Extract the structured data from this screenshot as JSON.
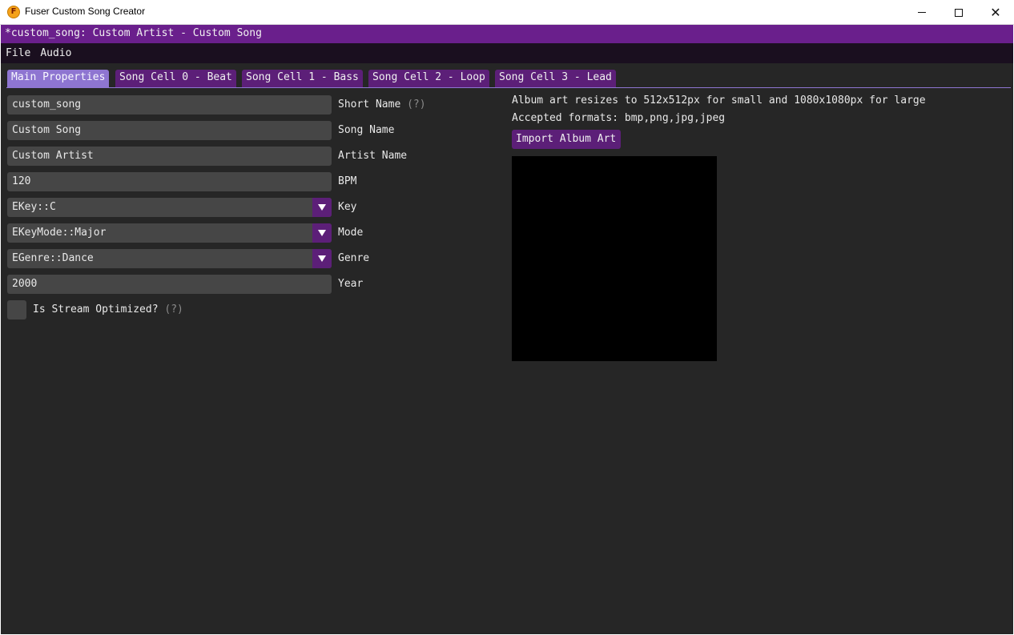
{
  "window": {
    "title": "Fuser Custom Song Creator",
    "icon_letter": "F",
    "controls": {
      "minimize": "minimize-icon",
      "maximize": "maximize-icon",
      "close": "close-icon"
    },
    "close_glyph": "✕"
  },
  "document": {
    "title": "*custom_song: Custom Artist - Custom Song"
  },
  "menu": [
    {
      "label": "File"
    },
    {
      "label": "Audio"
    }
  ],
  "tabs": [
    {
      "label": "Main Properties",
      "active": true
    },
    {
      "label": "Song Cell 0 - Beat",
      "active": false
    },
    {
      "label": "Song Cell 1 - Bass",
      "active": false
    },
    {
      "label": "Song Cell 2 - Loop",
      "active": false
    },
    {
      "label": "Song Cell 3 - Lead",
      "active": false
    }
  ],
  "form": {
    "short_name": {
      "value": "custom_song",
      "label": "Short Name",
      "hint": "(?)"
    },
    "song_name": {
      "value": "Custom Song",
      "label": "Song Name"
    },
    "artist_name": {
      "value": "Custom Artist",
      "label": "Artist Name"
    },
    "bpm": {
      "value": "120",
      "label": "BPM"
    },
    "key": {
      "value": "EKey::C",
      "label": "Key"
    },
    "mode": {
      "value": "EKeyMode::Major",
      "label": "Mode"
    },
    "genre": {
      "value": "EGenre::Dance",
      "label": "Genre"
    },
    "year": {
      "value": "2000",
      "label": "Year"
    },
    "stream_optimized": {
      "label": "Is Stream Optimized?",
      "hint": "(?)",
      "checked": false
    }
  },
  "album_art": {
    "info_line1": "Album art resizes to 512x512px for small and 1080x1080px for large",
    "info_line2": "Accepted formats: bmp,png,jpg,jpeg",
    "import_label": "Import Album Art"
  },
  "colors": {
    "accent": "#6a1f8c",
    "button": "#5c1f78",
    "tab_active": "#8e75d1",
    "background": "#262626",
    "field": "#464646"
  }
}
